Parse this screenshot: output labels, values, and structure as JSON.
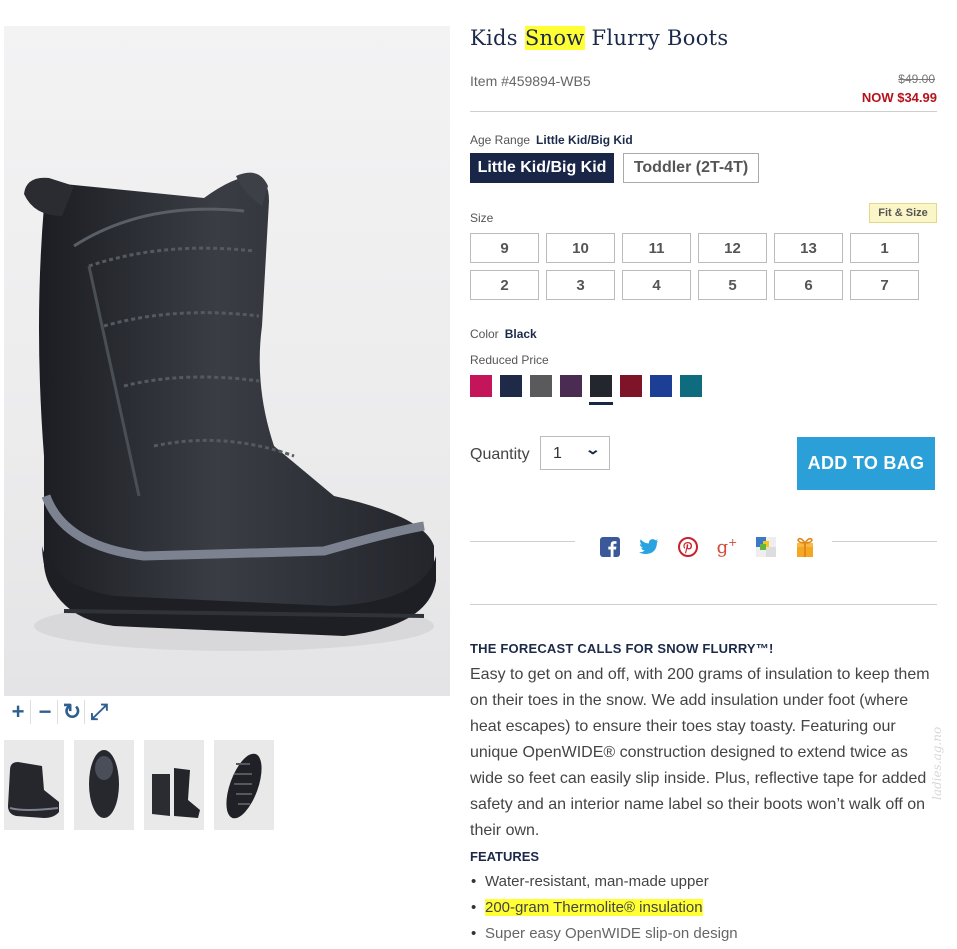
{
  "product": {
    "title_before": "Kids ",
    "title_highlight": "Snow",
    "title_after": " Flurry Boots",
    "item_number": "Item #459894-WB5",
    "price_old": "$49.00",
    "price_now": "NOW $34.99"
  },
  "age_range": {
    "label": "Age Range",
    "value": "Little Kid/Big Kid",
    "options": [
      "Little Kid/Big Kid",
      "Toddler (2T-4T)"
    ],
    "selected_index": 0
  },
  "size": {
    "label": "Size",
    "fit_link": "Fit & Size",
    "options": [
      "9",
      "10",
      "11",
      "12",
      "13",
      "1",
      "2",
      "3",
      "4",
      "5",
      "6",
      "7"
    ]
  },
  "color": {
    "label": "Color",
    "value": "Black",
    "price_note": "Reduced Price",
    "swatches": [
      "#c4155a",
      "#1e2a48",
      "#5a5a5c",
      "#4a2b52",
      "#23262d",
      "#7e1428",
      "#1c3f95",
      "#0f6b7e"
    ],
    "selected_index": 4
  },
  "quantity": {
    "label": "Quantity",
    "value": "1",
    "chevron_icon": "chevron-down-icon"
  },
  "add_to_bag_label": "ADD TO BAG",
  "share": {
    "icons": [
      "facebook-icon",
      "twitter-icon",
      "pinterest-icon",
      "google-plus-icon",
      "delicious-icon",
      "gift-icon"
    ],
    "colors": {
      "facebook": "#3b5998",
      "twitter": "#2aa3e1",
      "pinterest": "#c8232c",
      "google_plus": "#d34836"
    }
  },
  "image_tools": {
    "zoom_in": "+",
    "zoom_out": "−",
    "rotate": "↻",
    "fullscreen": "⤢"
  },
  "description": {
    "heading": "THE FORECAST CALLS FOR SNOW FLURRY™!",
    "body": "Easy to get on and off, with 200 grams of insulation to keep them on their toes in the snow. We add insulation under foot (where heat escapes) to ensure their toes stay toasty. Featuring our unique OpenWIDE® construction designed to extend twice as wide so feet can easily slip inside. Plus, reflective tape for added safety and an interior name label so their boots won’t walk off on their own."
  },
  "features": {
    "heading": "FEATURES",
    "items": [
      "Water-resistant, man-made upper",
      "200-gram Thermolite® insulation",
      "Super easy OpenWIDE slip-on design"
    ]
  },
  "watermark": "ladies.ag.no",
  "colors": {
    "navy": "#1a2648",
    "accent_blue": "#2a9fd8",
    "sale_red": "#b5121b",
    "highlight": "#ffff33"
  }
}
